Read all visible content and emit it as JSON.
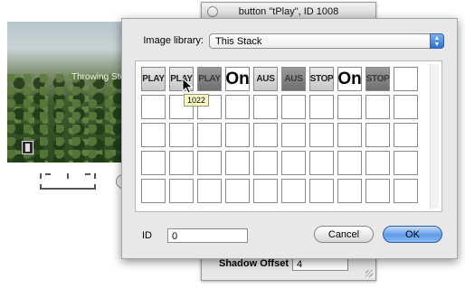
{
  "inspector": {
    "title": "button \"tPlay\", ID 1008",
    "shadow_offset_label": "Shadow Offset",
    "shadow_offset_value": "4"
  },
  "stack_window": {
    "caption": "Throwing Sto"
  },
  "dialog": {
    "library_label": "Image library:",
    "library_value": "This Stack",
    "tooltip": "1022",
    "id_label": "ID",
    "id_value": "0",
    "cancel_label": "Cancel",
    "ok_label": "OK",
    "images": [
      {
        "label": "PLAY",
        "style": "light"
      },
      {
        "label": "PLAY",
        "style": "light"
      },
      {
        "label": "PLAY",
        "style": "dark"
      },
      {
        "label": "On",
        "style": "big"
      },
      {
        "label": "AUS",
        "style": "light"
      },
      {
        "label": "AUS",
        "style": "dark"
      },
      {
        "label": "STOP",
        "style": "light"
      },
      {
        "label": "On",
        "style": "big"
      },
      {
        "label": "STOP",
        "style": "dark"
      },
      {
        "label": "",
        "style": "blank"
      }
    ],
    "empty_rows": 4
  },
  "colors": {
    "dialog_bg": "#e8e8e8",
    "ok_button": "#5d9ae8",
    "tooltip_bg": "#fffec8"
  }
}
